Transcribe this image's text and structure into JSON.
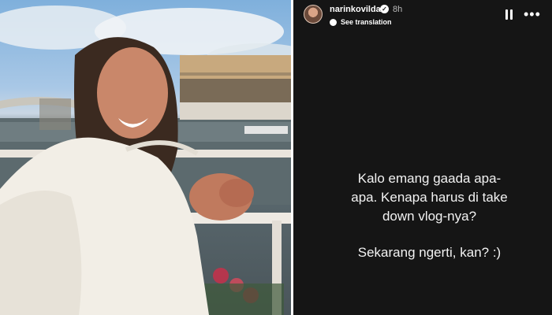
{
  "story": {
    "username": "narinkovilda",
    "time_ago": "8h",
    "translate_label": "See translation",
    "text_line1": "Kalo emang gaada apa-",
    "text_line2": "apa. Kenapa harus di take",
    "text_line3": "down vlog-nya?",
    "text_line4": "Sekarang ngerti, kan? :)"
  },
  "icons": {
    "avatar": "profile-avatar",
    "verified": "verified-badge-icon",
    "translate": "translate-icon",
    "pause": "pause-icon",
    "more": "more-options-icon"
  },
  "colors": {
    "story_bg": "#151515",
    "text": "#ffffff"
  }
}
